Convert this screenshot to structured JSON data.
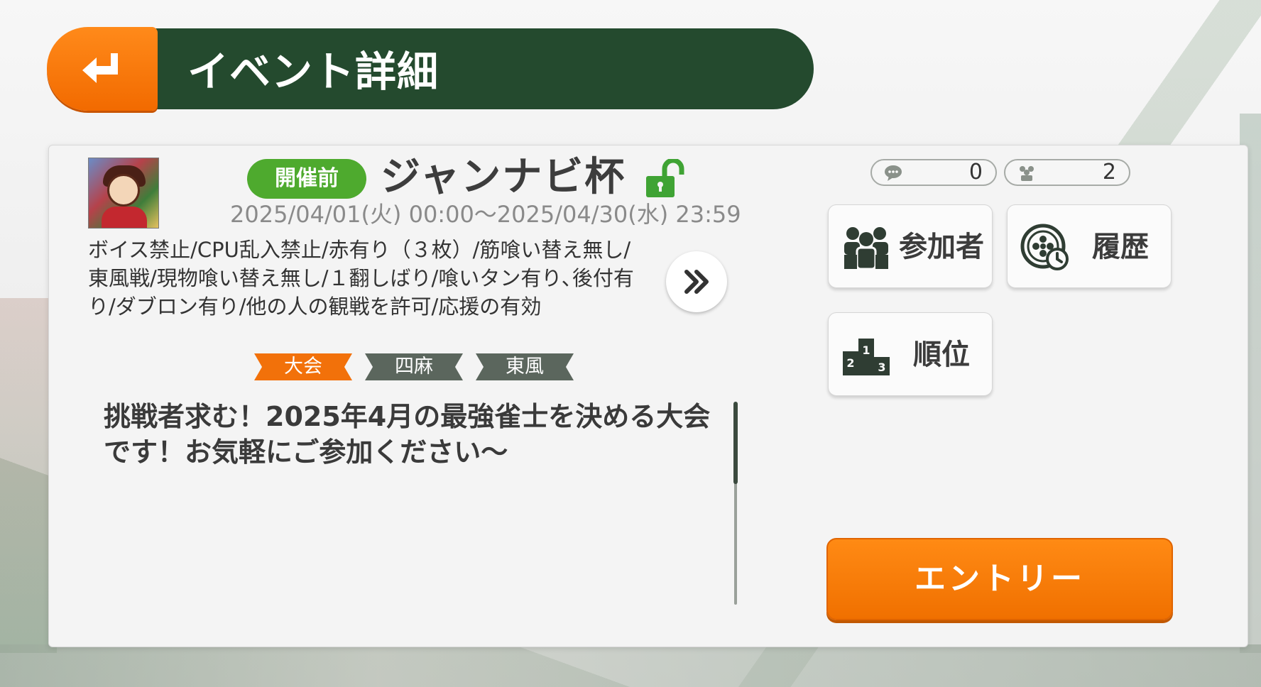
{
  "header": {
    "title": "イベント詳細"
  },
  "event": {
    "status": "開催前",
    "name": "ジャンナビ杯",
    "period": "2025/04/01(火) 00:00〜2025/04/30(水) 23:59",
    "rules": "ボイス禁止/CPU乱入禁止/赤有り（３枚）/筋喰い替え無し/東風戦/現物喰い替え無し/１翻しばり/喰いタン有り､後付有り/ダブロン有り/他の人の観戦を許可/応援の有効",
    "tags": [
      "大会",
      "四麻",
      "東風"
    ],
    "description": "挑戦者求む！2025年4月の最強雀士を決める大会です！お気軽にご参加ください〜"
  },
  "counters": {
    "comments": "0",
    "participants": "2"
  },
  "actions": {
    "participants_label": "参加者",
    "history_label": "履歴",
    "ranking_label": "順位",
    "entry_label": "エントリー"
  },
  "colors": {
    "header_bg": "#244a2e",
    "accent_orange": "#f26a00",
    "status_green": "#4eaa2e",
    "tag_gray": "#5b665d"
  },
  "icons": {
    "back": "return-arrow-icon",
    "lock": "unlocked-padlock-icon",
    "more": "double-chevron-right-icon",
    "comments": "speech-bubble-icon",
    "participants": "people-icon",
    "history": "mahjong-tile-clock-icon",
    "ranking": "podium-icon"
  }
}
